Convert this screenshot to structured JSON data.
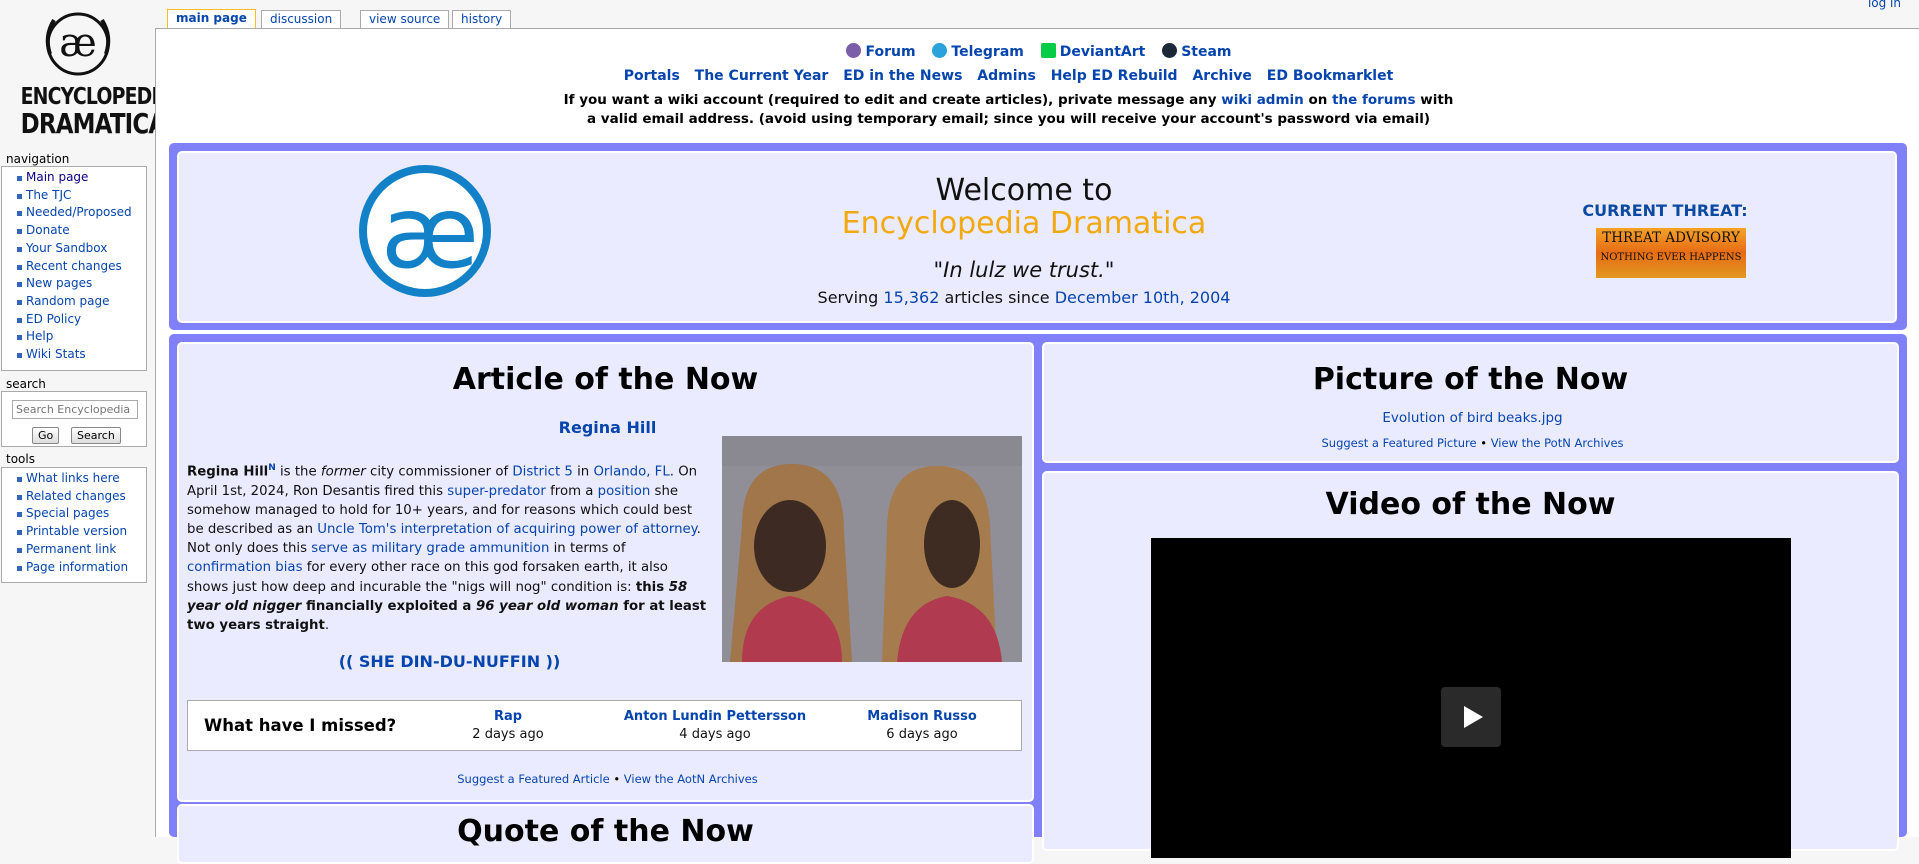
{
  "logo": {
    "line1": "ENCYCLOPEDIA",
    "line2": "DRAMATICA"
  },
  "tabs": [
    {
      "label": "main page"
    },
    {
      "label": "discussion"
    },
    {
      "label": "view source"
    },
    {
      "label": "history"
    }
  ],
  "login": "log in",
  "navigation": {
    "heading": "navigation",
    "items": [
      "Main page",
      "The TJC",
      "Needed/Proposed",
      "Donate",
      "Your Sandbox",
      "Recent changes",
      "New pages",
      "Random page",
      "ED Policy",
      "Help",
      "Wiki Stats"
    ]
  },
  "search": {
    "heading": "search",
    "placeholder": "Search Encyclopedia Dramatica",
    "go": "Go",
    "search": "Search"
  },
  "tools": {
    "heading": "tools",
    "items": [
      "What links here",
      "Related changes",
      "Special pages",
      "Printable version",
      "Permanent link",
      "Page information"
    ]
  },
  "icon_links": [
    {
      "label": "Forum",
      "icon": "forum-icon",
      "color": "#7b5ea7"
    },
    {
      "label": "Telegram",
      "icon": "telegram-icon",
      "color": "#2aa3dd"
    },
    {
      "label": "DeviantArt",
      "icon": "deviantart-icon",
      "color": "#05cc47"
    },
    {
      "label": "Steam",
      "icon": "steam-icon",
      "color": "#1b2838"
    }
  ],
  "nav_links": [
    "Portals",
    "The Current Year",
    "ED in the News",
    "Admins",
    "Help ED Rebuild",
    "Archive",
    "ED Bookmarklet"
  ],
  "notice": {
    "pre": "If you want a wiki account (required to edit and create articles), private message any ",
    "link1": "wiki admin",
    "mid": " on ",
    "link2": "the forums",
    "post": " with",
    "line2": "a valid email address. (avoid using temporary email; since you will receive your account's password via email)"
  },
  "welcome": {
    "title": "Welcome to",
    "name": "Encyclopedia Dramatica",
    "motto": "\"In lulz we trust.\"",
    "serving_pre": "Serving ",
    "count": "15,362",
    "serving_mid": " articles since ",
    "since": "December 10th, 2004"
  },
  "threat": {
    "label": "CURRENT THREAT:",
    "line1": "THREAT ADVISORY",
    "line2": "NOTHING EVER HAPPENS"
  },
  "aotn": {
    "heading": "Article of the Now",
    "subject": "Regina Hill",
    "text": {
      "name": "Regina Hill",
      "sup": "N",
      "t1": " is the ",
      "former": "former",
      "t2": " city commissioner of ",
      "l_district": "District 5",
      "t3": " in ",
      "l_orlando": "Orlando, FL",
      "t4": ". On April 1st, 2024, Ron Desantis fired this ",
      "l_super": "super-predator",
      "t5": " from a ",
      "l_position": "position",
      "t6": " she somehow managed to hold for 10+ years, and for reasons which could best be described as an ",
      "l_uncle": "Uncle Tom's interpretation of acquiring power of attorney",
      "t7": ". Not only does this ",
      "l_serve": "serve as military grade ammunition",
      "t8": " in terms of ",
      "l_conf": "confirmation bias",
      "t9": " for every other race on this god forsaken earth, it also shows just how deep and incurable the \"nigs will nog\" condition is: ",
      "b1": "this ",
      "bi1": "58 year old nigger",
      "b2": " financially exploited a ",
      "bi2": "96 year old woman",
      "b3": " for at least two years straight",
      "t10": "."
    },
    "dindu": "(( SHE DIN-DU-NUFFIN ))",
    "missed": {
      "label": "What have I missed?",
      "items": [
        {
          "name": "Rap",
          "ago": "2 days ago"
        },
        {
          "name": "Anton Lundin Pettersson",
          "ago": "4 days ago"
        },
        {
          "name": "Madison Russo",
          "ago": "6 days ago"
        }
      ]
    },
    "foot_suggest": "Suggest a Featured Article",
    "foot_sep": " • ",
    "foot_archive": "View the AotN Archives"
  },
  "potn": {
    "heading": "Picture of the Now",
    "file": "Evolution of bird beaks.jpg",
    "foot_suggest": "Suggest a Featured Picture",
    "foot_sep": " • ",
    "foot_archive": "View the PotN Archives"
  },
  "votn": {
    "heading": "Video of the Now"
  },
  "qotn": {
    "heading": "Quote of the Now"
  }
}
